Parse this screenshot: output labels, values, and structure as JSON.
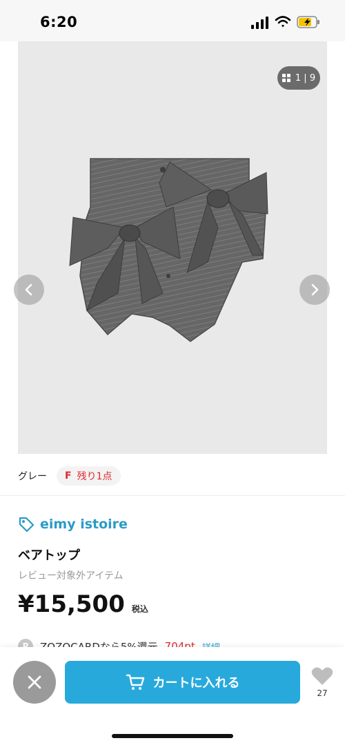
{
  "status_bar": {
    "time": "6:20"
  },
  "gallery": {
    "counter": "1 | 9",
    "icons": {
      "prev": "chevron-left-icon",
      "next": "chevron-right-icon",
      "grid": "grid-icon"
    },
    "image_alt": "gray pinstripe bandeau top with two large bows"
  },
  "variant": {
    "color": "グレー",
    "size": "F",
    "stock": "残り1点"
  },
  "product": {
    "brand": "eimy istoire",
    "name": "ベアトップ",
    "review_note": "レビュー対象外アイテム",
    "price": "¥15,500",
    "tax_label": "税込"
  },
  "zozocard": {
    "badge": "P",
    "text": "ZOZOCARDなら5%還元",
    "points": "704pt",
    "link": "詳細"
  },
  "actions": {
    "cart_label": "カートに入れる",
    "favorite_count": "27"
  },
  "colors": {
    "accent": "#28a9dc",
    "brand": "#2a9bc7",
    "alert": "#e0282e"
  }
}
